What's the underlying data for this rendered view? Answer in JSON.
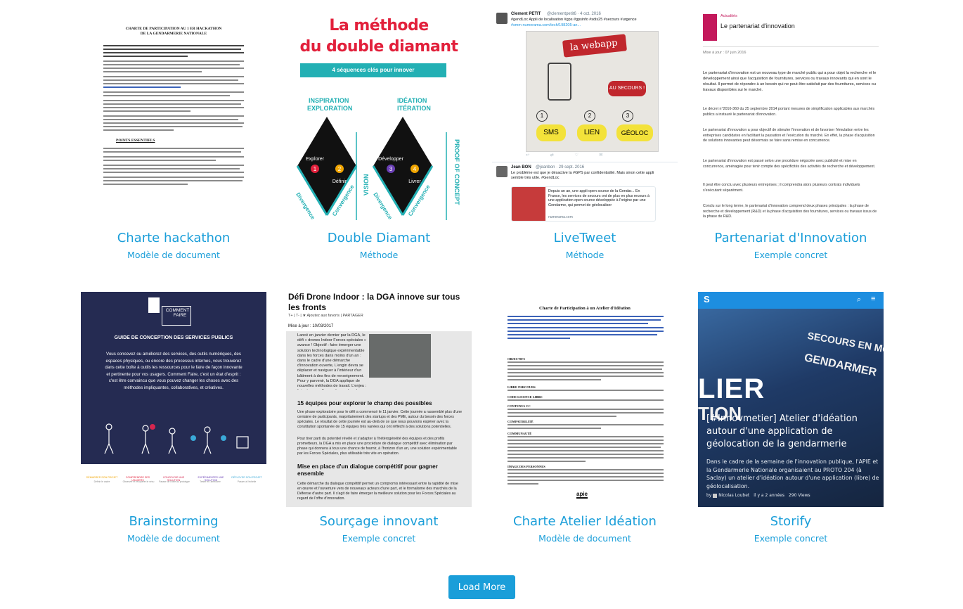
{
  "cards": [
    {
      "title": "Charte hackathon",
      "subtitle": "Modèle de document",
      "thumb": {
        "heading": "CHARTE DE PARTICIPATION AU 1 ER HACKATHON DE LA GENDARMERIE NATIONALE",
        "section": "POINTS ESSENTIELS"
      }
    },
    {
      "title": "Double Diamant",
      "subtitle": "Méthode",
      "thumb": {
        "heading_line1": "La méthode",
        "heading_line2": "du double diamant",
        "banner": "4 séquences clés pour innover",
        "left_label_1": "INSPIRATION",
        "left_label_2": "EXPLORATION",
        "right_label_1": "IDÉATION",
        "right_label_2": "ITÉRATION",
        "step1": "Explorer",
        "step2": "Définir",
        "step3": "Développer",
        "step4": "Livrer",
        "vision": "VISION",
        "proof": "PROOF OF CONCEPT",
        "divergence": "Divergence",
        "convergence": "Convergence",
        "n1": "1",
        "n2": "2",
        "n3": "3",
        "n4": "4"
      }
    },
    {
      "title": "LiveTweet",
      "subtitle": "Méthode",
      "thumb": {
        "author1": "Clement PETIT",
        "handle1": "@clementpetit6 · 4 oct. 2016",
        "text1": "#gendLoc Appli de localisation #gps #gpsinfo #sdis25 #secours #urgence",
        "link1": "#smm numerama.com/tech/198205-an...",
        "board_title": "la webapp",
        "sketch_sms": "SMS",
        "sketch_lien": "LIEN",
        "sketch_geo": "GÉOLOC",
        "sketch_secours": "AU SECOURS !",
        "sketch_n1": "1",
        "sketch_n2": "2",
        "sketch_n3": "3",
        "author2": "Jean BON",
        "handle2": "@jeanbon · 29 sept. 2016",
        "text2": "Le problème est que je désactive la #GPS par confidentialité. Mais sinon cette appli semble très utile. #GendLoc",
        "card_text": "Depuis un an, une appli open source de la Gendar... En France, les services de secours ont de plus en plus recours à une application open source développée à l'origine par une Gendarme, qui permet de géolocaliser",
        "card_source": "numerama.com"
      }
    },
    {
      "title": "Partenariat d'Innovation",
      "subtitle": "Exemple concret",
      "thumb": {
        "category": "Actualités",
        "heading": "Le partenariat d'innovation",
        "date": "Mise à jour : 07 juin 2016",
        "para1": "Le partenariat d'innovation est un nouveau type de marché public qui a pour objet la recherche et le développement ainsi que l'acquisition de fournitures, services ou travaux innovants qui en sont le résultat. Il permet de répondre à un besoin qui ne peut être satisfait par des fournitures, services ou travaux disponibles sur le marché.",
        "para2": "Le décret n°2016-360 du 25 septembre 2014 portant mesures de simplification applicables aux marchés publics a instauré le partenariat d'innovation.",
        "para3": "Le partenariat d'innovation a pour objectif de stimuler l'innovation et de favoriser l'émulation entre les entreprises candidates en facilitant la passation et l'exécution du marché. En effet, la phase d'acquisition de solutions innovantes peut désormais se faire sans remise en concurrence.",
        "para4": "Le partenariat d'innovation est passé selon une procédure négociée avec publicité et mise en concurrence, aménagée pour tenir compte des spécificités des activités de recherche et développement.",
        "para5": "Il peut être conclu avec plusieurs entreprises ; il comprendra alors plusieurs contrats individuels s'exécutant séparément.",
        "para6": "Conclu sur le long terme, le partenariat d'innovation comprend deux phases principales : la phase de recherche et développement (R&D) et la phase d'acquisition des fournitures, services ou travaux issus de la phase de R&D."
      }
    },
    {
      "title": "Brainstorming",
      "subtitle": "Modèle de document",
      "thumb": {
        "logo_line1": "COMMENT",
        "logo_line2": "FAIRE",
        "heading": "GUIDE DE CONCEPTION DES SERVICES PUBLICS",
        "body": "Vous concevez ou améliorez des services, des outils numériques, des espaces physiques, ou encore des processus internes, vous trouverez dans cette boîte à outils les ressources pour le faire de façon innovante et pertinente pour vos usagers. Comment Faire, c'est un état d'esprit : c'est être convaincu que vous pouvez changer les choses avec des méthodes impliquantes, collaboratives, et créatives.",
        "step1": "DÉMARRER SON PROJET",
        "step2": "COMPRENDRE SES USAGERS",
        "step3": "CONCEVOIR UNE SOLUTION",
        "step4": "EXPÉRIMENTER UNE SOLUTION",
        "step5": "DÉPLOYER SON PROJET",
        "sub1": "Définir le cadre",
        "sub2": "Observer et récupérer le vécu",
        "sub3": "Passer de l'idée au prototype",
        "sub4": "Tester et l'améliorer",
        "sub5": "Passer à l'échelle"
      }
    },
    {
      "title": "Sourçage innovant",
      "subtitle": "Exemple concret",
      "thumb": {
        "heading": "Défi Drone Indoor : la DGA innove sur tous les fronts",
        "toolbar": "T+ | T- | ★ Ajoutez aux favoris | PARTAGER",
        "date": "Mise à jour : 10/03/2017",
        "intro": "Lancé en janvier dernier par la DGA, le défi « drones Indoor Forces spéciales » avance ! Objectif : faire émerger une solution technologique expérimentable dans les forces dans moins d'un an : dans le cadre d'une démarche d'innovation ouverte, L'engin devra se déplacer et naviguer à l'intérieur d'un bâtiment à des fins de renseignement. Pour y parvenir, la DGA applique de nouvelles méthodes de travail. L'enjeu : faire émerger l'innovation en boucle courte. Explications",
        "h2": "15 équipes pour explorer le champ des possibles",
        "p2": "Une phase exploratoire pour le défi a commencé le 11 janvier. Cette journée a rassemblé plus d'une centaine de participants, majoritairement des startups et des PME, autour du besoin des forces spéciales. Le résultat de cette journée est au-delà de ce que nous pouvions espérer avec la constitution spontanée de 15 équipes très variées qui ont réfléchi à des solutions potentielles.",
        "p3": "Pour tirer parti du potentiel révélé et s'adapter à l'hétérogénéité des équipes et des profils prometteurs, la DGA a mis en place une procédure de dialogue compétitif avec élimination par phase qui donnera à tous une chance de fournir, à l'horizon d'un an, une solution expérimentable par les Forces Spéciales, plus utilisable très vite en opération.",
        "h3": "Mise en place d'un dialogue compétitif pour gagner ensemble",
        "p4": "Cette démarche du dialogue compétitif permet un compromis intéressant entre la rapidité de mise en œuvre et l'ouverture vers de nouveaux acteurs d'une part, et le formalisme des marchés de la Défense d'autre part. Il s'agit de faire émerger la meilleure solution pour les Forces Spéciales au regard de l'offre d'innovation."
      }
    },
    {
      "title": "Charte Atelier Idéation",
      "subtitle": "Modèle de document",
      "thumb": {
        "heading": "Charte de Participation à un Atelier d'Idéation",
        "s1": "OBJECTIFS",
        "s2": "LIBRE PARCOURS",
        "s3": "CODE LICENCE LIBRE",
        "s4": "CONTENUS CC",
        "s5": "COMPATIBILITÉ",
        "s6": "COMMUNAUTÉ",
        "s7": "IMAGE DES PERSONNES",
        "footer_logo": "apie"
      }
    },
    {
      "title": "Storify",
      "subtitle": "Exemple concret",
      "thumb": {
        "brand": "S",
        "photo_text1": "SECOURS EN MO",
        "photo_text2": "GENDARMER",
        "big_text1": "LIER",
        "big_text2": "TION",
        "headline": "[#Innovmetier] Atelier d'idéation autour d'une application de géolocation de la gendarmerie",
        "summary": "Dans le cadre de la semaine de l'innovation publique, l'APIE et la Gendarmerie Nationale organisaient au PROTO 204 (à Saclay) un atelier d'idéation autour d'une application (libre) de géolocalisation.",
        "by": "by",
        "author": "Nicolas Loubet",
        "age": "il y a 2 années",
        "views": "290 Views"
      }
    }
  ],
  "load_more_label": "Load More"
}
